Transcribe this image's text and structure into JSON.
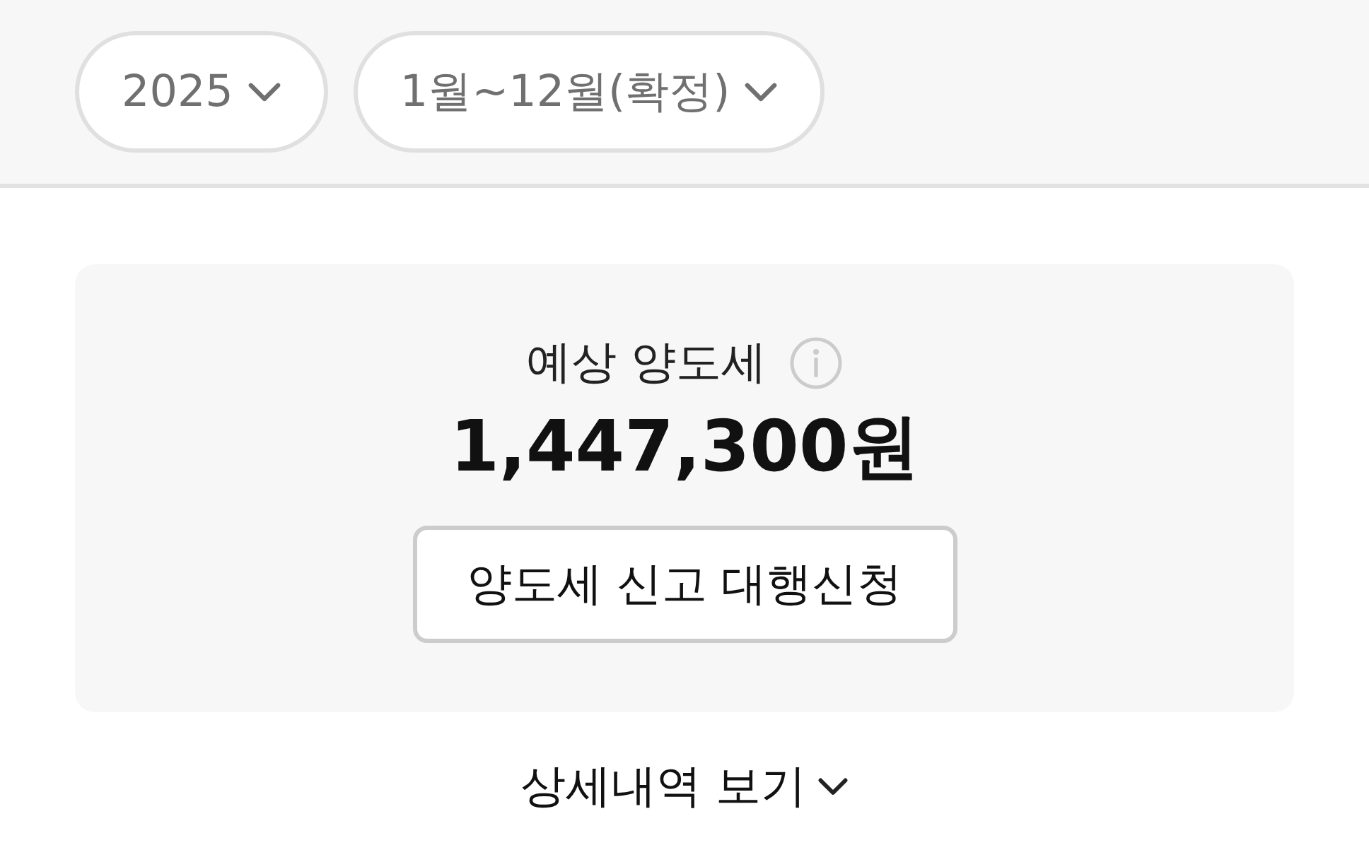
{
  "filters": [
    {
      "label": "2025"
    },
    {
      "label": "1월~12월(확정)"
    }
  ],
  "summary": {
    "label": "예상 양도세",
    "amount": "1,447,300원",
    "action": "양도세 신고 대행신청"
  },
  "details_toggle": {
    "label": "상세내역 보기",
    "expanded": false
  }
}
